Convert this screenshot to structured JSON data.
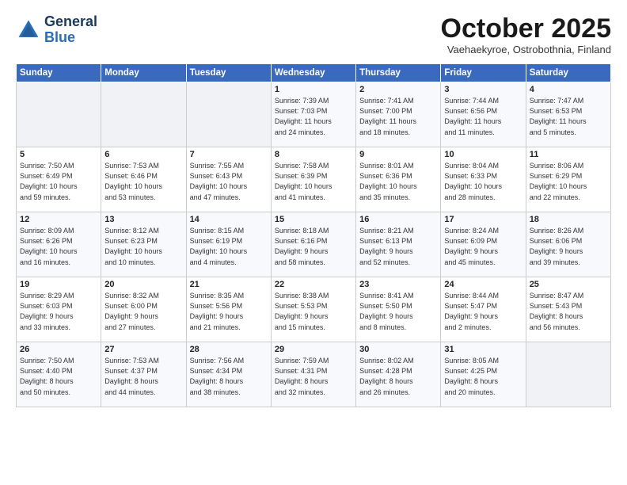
{
  "logo": {
    "line1": "General",
    "line2": "Blue"
  },
  "title": "October 2025",
  "subtitle": "Vaehaekyroe, Ostrobothnia, Finland",
  "weekdays": [
    "Sunday",
    "Monday",
    "Tuesday",
    "Wednesday",
    "Thursday",
    "Friday",
    "Saturday"
  ],
  "weeks": [
    [
      {
        "day": "",
        "info": ""
      },
      {
        "day": "",
        "info": ""
      },
      {
        "day": "",
        "info": ""
      },
      {
        "day": "1",
        "info": "Sunrise: 7:39 AM\nSunset: 7:03 PM\nDaylight: 11 hours\nand 24 minutes."
      },
      {
        "day": "2",
        "info": "Sunrise: 7:41 AM\nSunset: 7:00 PM\nDaylight: 11 hours\nand 18 minutes."
      },
      {
        "day": "3",
        "info": "Sunrise: 7:44 AM\nSunset: 6:56 PM\nDaylight: 11 hours\nand 11 minutes."
      },
      {
        "day": "4",
        "info": "Sunrise: 7:47 AM\nSunset: 6:53 PM\nDaylight: 11 hours\nand 5 minutes."
      }
    ],
    [
      {
        "day": "5",
        "info": "Sunrise: 7:50 AM\nSunset: 6:49 PM\nDaylight: 10 hours\nand 59 minutes."
      },
      {
        "day": "6",
        "info": "Sunrise: 7:53 AM\nSunset: 6:46 PM\nDaylight: 10 hours\nand 53 minutes."
      },
      {
        "day": "7",
        "info": "Sunrise: 7:55 AM\nSunset: 6:43 PM\nDaylight: 10 hours\nand 47 minutes."
      },
      {
        "day": "8",
        "info": "Sunrise: 7:58 AM\nSunset: 6:39 PM\nDaylight: 10 hours\nand 41 minutes."
      },
      {
        "day": "9",
        "info": "Sunrise: 8:01 AM\nSunset: 6:36 PM\nDaylight: 10 hours\nand 35 minutes."
      },
      {
        "day": "10",
        "info": "Sunrise: 8:04 AM\nSunset: 6:33 PM\nDaylight: 10 hours\nand 28 minutes."
      },
      {
        "day": "11",
        "info": "Sunrise: 8:06 AM\nSunset: 6:29 PM\nDaylight: 10 hours\nand 22 minutes."
      }
    ],
    [
      {
        "day": "12",
        "info": "Sunrise: 8:09 AM\nSunset: 6:26 PM\nDaylight: 10 hours\nand 16 minutes."
      },
      {
        "day": "13",
        "info": "Sunrise: 8:12 AM\nSunset: 6:23 PM\nDaylight: 10 hours\nand 10 minutes."
      },
      {
        "day": "14",
        "info": "Sunrise: 8:15 AM\nSunset: 6:19 PM\nDaylight: 10 hours\nand 4 minutes."
      },
      {
        "day": "15",
        "info": "Sunrise: 8:18 AM\nSunset: 6:16 PM\nDaylight: 9 hours\nand 58 minutes."
      },
      {
        "day": "16",
        "info": "Sunrise: 8:21 AM\nSunset: 6:13 PM\nDaylight: 9 hours\nand 52 minutes."
      },
      {
        "day": "17",
        "info": "Sunrise: 8:24 AM\nSunset: 6:09 PM\nDaylight: 9 hours\nand 45 minutes."
      },
      {
        "day": "18",
        "info": "Sunrise: 8:26 AM\nSunset: 6:06 PM\nDaylight: 9 hours\nand 39 minutes."
      }
    ],
    [
      {
        "day": "19",
        "info": "Sunrise: 8:29 AM\nSunset: 6:03 PM\nDaylight: 9 hours\nand 33 minutes."
      },
      {
        "day": "20",
        "info": "Sunrise: 8:32 AM\nSunset: 6:00 PM\nDaylight: 9 hours\nand 27 minutes."
      },
      {
        "day": "21",
        "info": "Sunrise: 8:35 AM\nSunset: 5:56 PM\nDaylight: 9 hours\nand 21 minutes."
      },
      {
        "day": "22",
        "info": "Sunrise: 8:38 AM\nSunset: 5:53 PM\nDaylight: 9 hours\nand 15 minutes."
      },
      {
        "day": "23",
        "info": "Sunrise: 8:41 AM\nSunset: 5:50 PM\nDaylight: 9 hours\nand 8 minutes."
      },
      {
        "day": "24",
        "info": "Sunrise: 8:44 AM\nSunset: 5:47 PM\nDaylight: 9 hours\nand 2 minutes."
      },
      {
        "day": "25",
        "info": "Sunrise: 8:47 AM\nSunset: 5:43 PM\nDaylight: 8 hours\nand 56 minutes."
      }
    ],
    [
      {
        "day": "26",
        "info": "Sunrise: 7:50 AM\nSunset: 4:40 PM\nDaylight: 8 hours\nand 50 minutes."
      },
      {
        "day": "27",
        "info": "Sunrise: 7:53 AM\nSunset: 4:37 PM\nDaylight: 8 hours\nand 44 minutes."
      },
      {
        "day": "28",
        "info": "Sunrise: 7:56 AM\nSunset: 4:34 PM\nDaylight: 8 hours\nand 38 minutes."
      },
      {
        "day": "29",
        "info": "Sunrise: 7:59 AM\nSunset: 4:31 PM\nDaylight: 8 hours\nand 32 minutes."
      },
      {
        "day": "30",
        "info": "Sunrise: 8:02 AM\nSunset: 4:28 PM\nDaylight: 8 hours\nand 26 minutes."
      },
      {
        "day": "31",
        "info": "Sunrise: 8:05 AM\nSunset: 4:25 PM\nDaylight: 8 hours\nand 20 minutes."
      },
      {
        "day": "",
        "info": ""
      }
    ]
  ],
  "colors": {
    "header_bg": "#3a6abf",
    "header_text": "#ffffff",
    "odd_row": "#f7f9fc",
    "even_row": "#ffffff",
    "empty_cell": "#f0f2f5"
  }
}
